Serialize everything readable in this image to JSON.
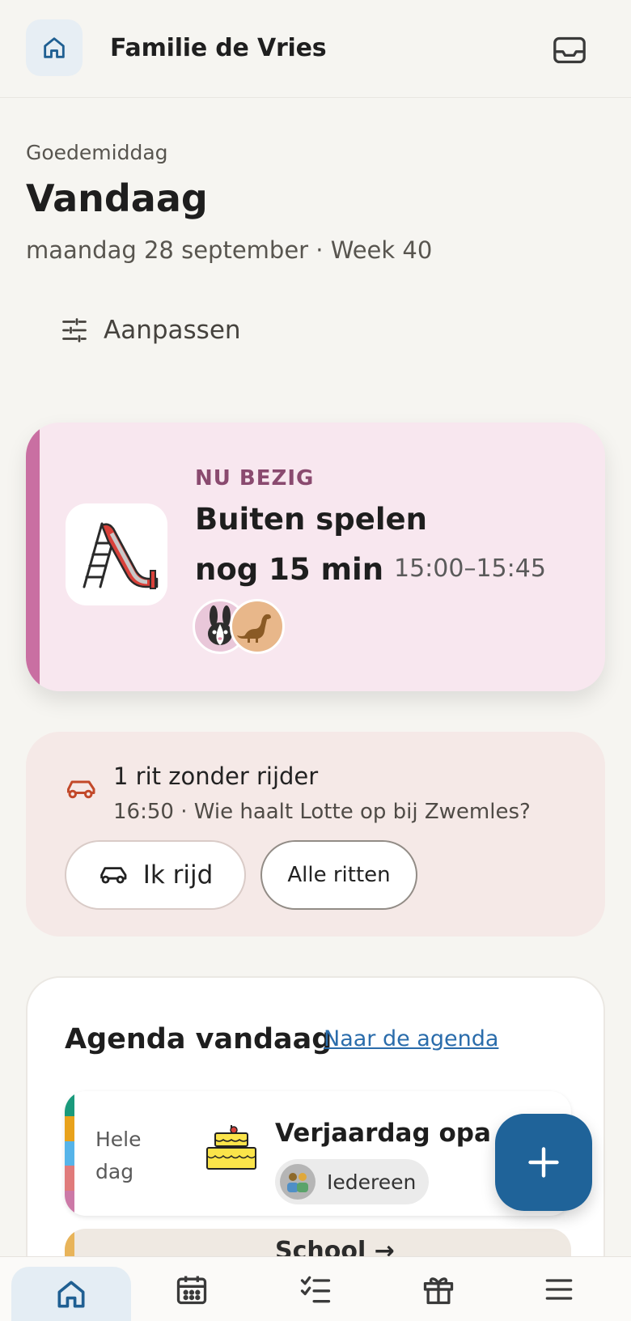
{
  "header": {
    "title": "Familie de Vries",
    "home_icon": "home-icon",
    "inbox_icon": "inbox-icon"
  },
  "greeting": {
    "salutation": "Goedemiddag",
    "title": "Vandaag",
    "date": "maandag 28 september · Week 40",
    "customize_label": "Aanpassen"
  },
  "now_card": {
    "label": "NU BEZIG",
    "title": "Buiten spelen",
    "remaining": "nog 15 min",
    "time": "15:00–15:45",
    "icon": "slide-icon",
    "accent": "#c96fa2",
    "avatars": [
      "bunny-avatar",
      "dinosaur-avatar"
    ]
  },
  "ride_card": {
    "title": "1 rit zonder rijder",
    "subtitle": "16:50 · Wie haalt Lotte op bij Zwemles?",
    "primary_button": "Ik rijd",
    "secondary_button": "Alle ritten",
    "accent": "#c2492a"
  },
  "agenda": {
    "title": "Agenda vandaag",
    "link": "Naar de agenda",
    "events": [
      {
        "time_line1": "Hele",
        "time_line2": "dag",
        "title": "Verjaardag opa",
        "icon": "birthday-cake-icon",
        "chip": "Iedereen",
        "colors": [
          "#1a9a7c",
          "#e8a21c",
          "#56b4e9",
          "#e07b7b",
          "#cc79a7"
        ]
      }
    ],
    "next_event_partial": "School →"
  },
  "fab": {
    "icon": "plus-icon",
    "color": "#1f6399"
  },
  "bottom_nav": [
    {
      "name": "home",
      "icon": "home-icon",
      "active": true
    },
    {
      "name": "calendar",
      "icon": "calendar-icon",
      "active": false
    },
    {
      "name": "tasks",
      "icon": "checklist-icon",
      "active": false
    },
    {
      "name": "wishlist",
      "icon": "gift-icon",
      "active": false
    },
    {
      "name": "menu",
      "icon": "menu-icon",
      "active": false
    }
  ]
}
